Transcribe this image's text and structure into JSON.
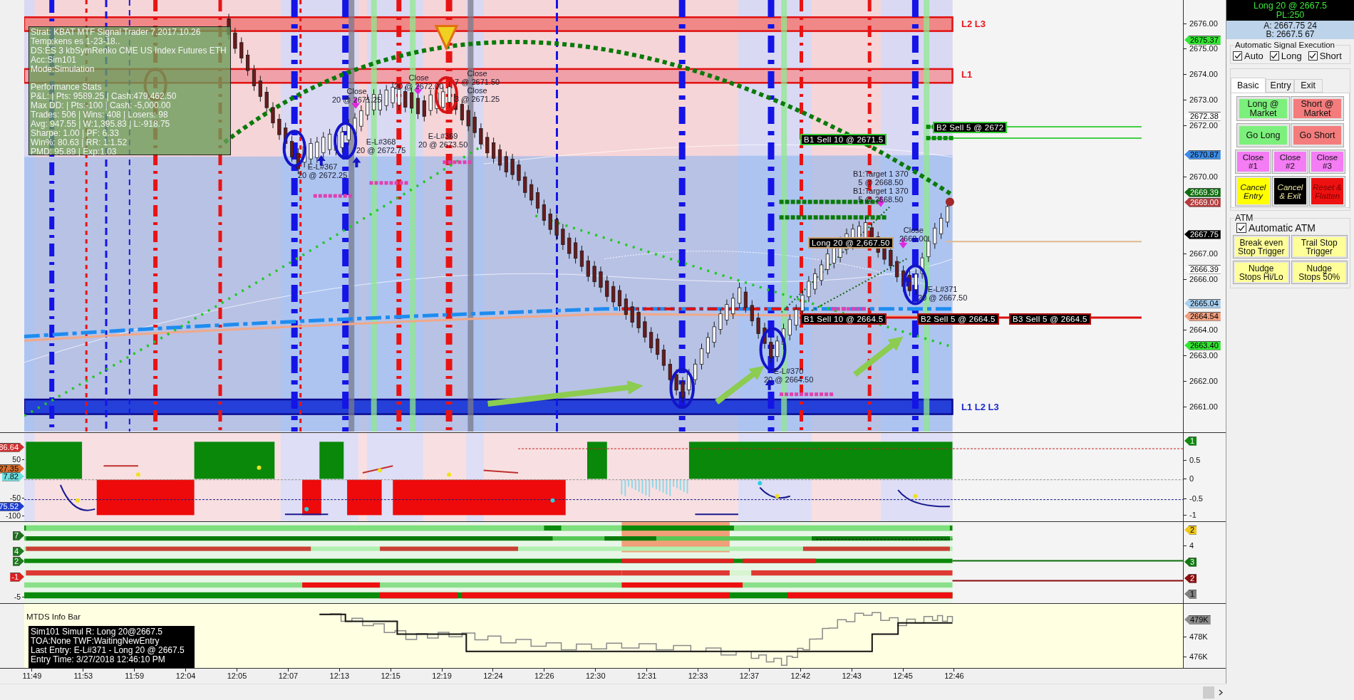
{
  "chart": {
    "info_panel": {
      "header_lines": [
        "Strat:  KBAT MTF Signal Trader 7.2017.10.26",
        "Temp:kens es 1-23-18..",
        "DS:ES 3 kbSymRenko  CME US Index Futures ETH",
        "Acc:Sim101",
        "Mode:Simulation"
      ],
      "stats_title": "Performance Stats",
      "stats_lines": [
        "P&L: | Pts: 9589.25 | Cash:479,462.50",
        "Max DD: | Pts:-100 | Cash: -5,000.00",
        "Trades: 506 | Wins: 408 | Losers: 98",
        "Avg: 947.55 | W:1,395.83 | L:-918.75",
        "Sharpe: 1.00 | PF: 6.33",
        "Win%: 80.63 | RR: 1:1.52",
        "PMD: 95.89 | Exp:1.03"
      ]
    },
    "level_labels": [
      {
        "text": "L2 L3",
        "color": "#e8141e"
      },
      {
        "text": "L1",
        "color": "#e8141e"
      },
      {
        "text": "L1 L2 L3",
        "color": "#1a2ad0"
      }
    ],
    "trade_notes": [
      {
        "lines": [
          "Close",
          "20 @ 2671.25"
        ]
      },
      {
        "lines": [
          "Close",
          "20 @ 2672.00"
        ]
      },
      {
        "lines": [
          "Close",
          "7 @ 2671.50",
          "Close",
          "3 @ 2671.25"
        ]
      },
      {
        "lines": [
          "E-L#367",
          "20 @ 2672.25"
        ]
      },
      {
        "lines": [
          "E-L#368",
          "20 @ 2672.75"
        ]
      },
      {
        "lines": [
          "E-L#369",
          "20 @ 2673.50"
        ]
      },
      {
        "lines": [
          "B1:Target 1 370",
          "5 @ 2668.50",
          "B1:Target 1 370",
          "5 @ 2668.50"
        ]
      },
      {
        "lines": [
          "Close",
          "2668.00"
        ]
      },
      {
        "lines": [
          "E-L#371",
          "20 @ 2667.50"
        ]
      },
      {
        "lines": [
          "E-L#370",
          "20 @ 2664.50"
        ]
      }
    ],
    "order_tags": [
      {
        "text": "B2 Sell 5  @ 2672",
        "color": "#33cc33"
      },
      {
        "text": "B1 Sell 10  @ 2671.5",
        "color": "#33cc33"
      },
      {
        "text": "Long 20 @ 2,667.50",
        "color": "#c8a070"
      },
      {
        "text": "B1 Sell 10  @ 2664.5",
        "color": "#b01010"
      },
      {
        "text": "B2 Sell 5  @ 2664.5",
        "color": "#b01010"
      },
      {
        "text": "B3 Sell 5  @ 2664.5",
        "color": "#b01010"
      }
    ]
  },
  "price_axis": {
    "ticks": [
      "2676.00",
      "2675.00",
      "2674.00",
      "2673.00",
      "2672.00",
      "2670.00",
      "2667.00",
      "2666.00",
      "2664.00",
      "2663.00",
      "2662.00",
      "2661.00"
    ],
    "tags": [
      {
        "text": "2675.37",
        "color": "#33e633"
      },
      {
        "text": "2672.38",
        "color": "#ffffff"
      },
      {
        "text": "2670.87",
        "color": "#3c8ce6"
      },
      {
        "text": "2669.39",
        "color": "#0f6e0f"
      },
      {
        "text": "2669.00",
        "color": "#b43c3c"
      },
      {
        "text": "2667.75",
        "color": "#000000"
      },
      {
        "text": "2666.39",
        "color": "#ffffff"
      },
      {
        "text": "2665.04",
        "color": "#a8d0f0"
      },
      {
        "text": "2664.54",
        "color": "#f0a080"
      },
      {
        "text": "2663.40",
        "color": "#33e633"
      }
    ]
  },
  "oscillator": {
    "left_tags": [
      {
        "text": "86.64",
        "color": "#d03030"
      },
      {
        "text": "27.35",
        "color": "#d87030"
      },
      {
        "text": "7.82",
        "color": "#70e0e0"
      },
      {
        "text": "75.52",
        "color": "#1c3cd0"
      }
    ],
    "left_ticks": [
      "50",
      "-50",
      "-100"
    ],
    "right_tags": [
      {
        "text": "1",
        "color": "#0f8c0f"
      }
    ],
    "right_ticks": [
      "0.5",
      "0",
      "-0.5",
      "-1"
    ]
  },
  "signal_strip": {
    "left_tags": [
      {
        "text": "7",
        "color": "#1e6e1e"
      },
      {
        "text": "4",
        "color": "#1e7a1e"
      },
      {
        "text": "2",
        "color": "#1e7a1e"
      },
      {
        "text": "-1",
        "color": "#dd2020"
      }
    ],
    "left_ticks": [
      "-5"
    ],
    "right_tags": [
      {
        "text": "2",
        "color": "#f0c81e"
      },
      {
        "text": "3",
        "color": "#0f780f"
      },
      {
        "text": "2",
        "color": "#8c0f0f"
      },
      {
        "text": "1",
        "color": "#808080"
      }
    ],
    "right_ticks": [
      "4"
    ]
  },
  "info_bar": {
    "title": "MTDS Info Bar",
    "lines": [
      "Sim101 Simul  R: Long 20@2667.5",
      "TOA:None TWF:WaitingNewEntry",
      "Last Entry: E-L#371 - Long 20 @ 2667.5",
      "Entry Time: 3/27/2018 12:46:10 PM"
    ],
    "right_tags": [
      {
        "text": "479K",
        "color": "#8c8c8c"
      }
    ],
    "right_ticks": [
      "478K",
      "476K"
    ]
  },
  "time_axis": [
    "11:49",
    "11:53",
    "11:59",
    "12:04",
    "12:05",
    "12:07",
    "12:13",
    "12:15",
    "12:19",
    "12:24",
    "12:26",
    "12:30",
    "12:31",
    "12:33",
    "12:37",
    "12:42",
    "12:43",
    "12:45",
    "12:46"
  ],
  "order_panel": {
    "position": [
      "Long 20 @ 2667.5",
      "PL:250"
    ],
    "quotes": [
      "A: 2667.75 24",
      "B: 2667.5 67"
    ],
    "auto_execution": {
      "title": "Automatic Signal Execution",
      "options": [
        {
          "label": "Auto",
          "checked": true
        },
        {
          "label": "Long",
          "checked": true
        },
        {
          "label": "Short",
          "checked": true
        }
      ]
    },
    "trade_wizard": {
      "tabs": [
        {
          "label": "Basic",
          "selected": true
        },
        {
          "label": "Entry",
          "selected": false
        },
        {
          "label": "Exit",
          "selected": false
        }
      ],
      "button_rows": [
        [
          {
            "lines": [
              "Long @",
              "Market"
            ],
            "color": "#7cf07c",
            "kind": "plain"
          },
          {
            "lines": [
              "Short @",
              "Market"
            ],
            "color": "#f47c7c",
            "kind": "plain"
          }
        ],
        [
          {
            "lines": [
              "Go Long"
            ],
            "color": "#7cf07c",
            "kind": "plain"
          },
          {
            "lines": [
              "Go Short"
            ],
            "color": "#f47c7c",
            "kind": "plain"
          }
        ],
        [
          {
            "lines": [
              "Close",
              "#1"
            ],
            "color": "#f47cf4",
            "kind": "plain"
          },
          {
            "lines": [
              "Close",
              "#2"
            ],
            "color": "#f47cf4",
            "kind": "plain"
          },
          {
            "lines": [
              "Close",
              "#3"
            ],
            "color": "#f47cf4",
            "kind": "plain"
          }
        ],
        [
          {
            "lines": [
              "Cancel",
              "Entry"
            ],
            "color": "#ffff00",
            "kind": "italic"
          },
          {
            "lines": [
              "Cancel",
              "& Exit"
            ],
            "color": "#000000",
            "kind": "italic"
          },
          {
            "lines": [
              "Reset &",
              "Flatten"
            ],
            "color": "#ee1111",
            "kind": "italic"
          }
        ]
      ]
    },
    "atm": {
      "title": "ATM",
      "auto_atm": {
        "label": "Automatic ATM",
        "checked": true
      },
      "buttons": [
        {
          "lines": [
            "Break even",
            "Stop Trigger"
          ]
        },
        {
          "lines": [
            "Trail Stop",
            "Trigger"
          ]
        },
        {
          "lines": [
            "Nudge",
            "Stops Hi/Lo"
          ]
        },
        {
          "lines": [
            "Nudge",
            "Stops 50%"
          ]
        }
      ]
    }
  }
}
